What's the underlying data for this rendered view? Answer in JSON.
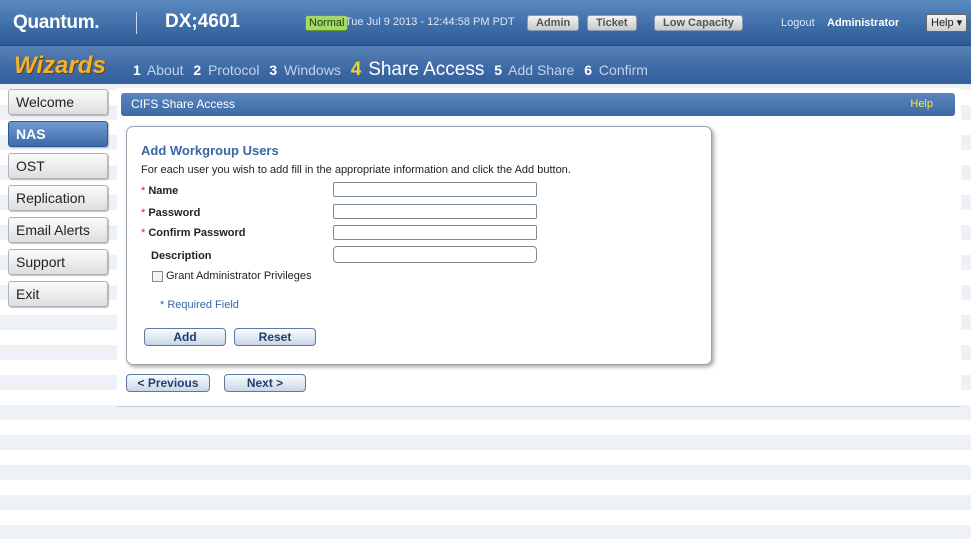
{
  "header": {
    "logo": "Quantum.",
    "model": "DX;4601",
    "status": "Normal",
    "datetime": "Tue Jul 9 2013 - 12:44:58 PM PDT",
    "admin_label": "Admin",
    "ticket_label": "Ticket",
    "capacity_label": "Low Capacity",
    "logout_label": "Logout",
    "user": "Administrator",
    "help_label": "Help ▾"
  },
  "wizard": {
    "logo": "Wizards",
    "steps": [
      {
        "num": "1",
        "label": "About"
      },
      {
        "num": "2",
        "label": "Protocol"
      },
      {
        "num": "3",
        "label": "Windows"
      },
      {
        "num": "4",
        "label": "Share Access"
      },
      {
        "num": "5",
        "label": "Add Share"
      },
      {
        "num": "6",
        "label": "Confirm"
      }
    ],
    "current_step": "4"
  },
  "nav": {
    "items": [
      {
        "label": "Welcome"
      },
      {
        "label": "NAS"
      },
      {
        "label": "OST"
      },
      {
        "label": "Replication"
      },
      {
        "label": "Email Alerts"
      },
      {
        "label": "Support"
      },
      {
        "label": "Exit"
      }
    ],
    "active": "NAS"
  },
  "panel": {
    "title": "CIFS Share Access",
    "help": "Help"
  },
  "form": {
    "title": "Add Workgroup Users",
    "description": "For each user you wish to add fill in the appropriate information and click the Add button.",
    "required_marker": "*",
    "name_label": "Name",
    "password_label": "Password",
    "confirm_label": "Confirm Password",
    "description_label": "Description",
    "name_value": "",
    "password_value": "",
    "confirm_value": "",
    "description_value": "",
    "grant_admin_label": "Grant Administrator Privileges",
    "required_note": "* Required Field",
    "add_label": "Add",
    "reset_label": "Reset"
  },
  "pager": {
    "previous_label": "< Previous",
    "next_label": "Next >"
  },
  "colors": {
    "header_blue": "#3f6ea9",
    "wizard_logo": "#f2b233",
    "status_green": "#a5d86b",
    "help_yellow": "#f5e84a",
    "form_title": "#3a66a3"
  }
}
